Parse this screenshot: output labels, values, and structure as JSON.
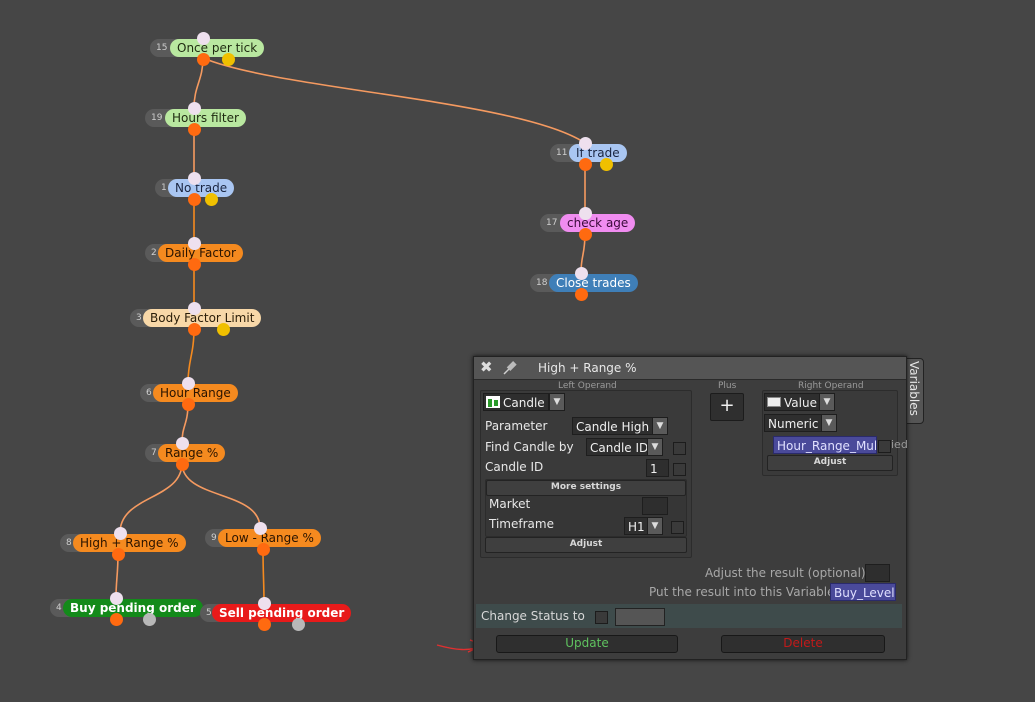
{
  "nodes": [
    {
      "id": "15",
      "label": "Once per tick",
      "color": "#b9e8a0",
      "text": "#1e2a10"
    },
    {
      "id": "19",
      "label": "Hours filter",
      "color": "#b9e8a0",
      "text": "#1e2a10"
    },
    {
      "id": "1",
      "label": "No trade",
      "color": "#a9c6f2",
      "text": "#1a2540"
    },
    {
      "id": "2",
      "label": "Daily Factor",
      "color": "#f58a1f",
      "text": "#2a1400"
    },
    {
      "id": "3",
      "label": "Body Factor Limit",
      "color": "#f8d8a8",
      "text": "#2a1d08"
    },
    {
      "id": "6",
      "label": "Hour Range",
      "color": "#f58a1f",
      "text": "#2a1400"
    },
    {
      "id": "7",
      "label": "Range %",
      "color": "#f58a1f",
      "text": "#2a1400"
    },
    {
      "id": "8",
      "label": "High + Range %",
      "color": "#f58a1f",
      "text": "#2a1400"
    },
    {
      "id": "9",
      "label": "Low - Range %",
      "color": "#f58a1f",
      "text": "#2a1400"
    },
    {
      "id": "4",
      "label": "Buy pending order",
      "color": "#138a1a",
      "text": "#ffffff"
    },
    {
      "id": "5",
      "label": "Sell pending order",
      "color": "#e81a1a",
      "text": "#ffffff"
    },
    {
      "id": "11",
      "label": "If trade",
      "color": "#a9c6f2",
      "text": "#1a2540"
    },
    {
      "id": "17",
      "label": "check age",
      "color": "#f08cf0",
      "text": "#3a0a3a"
    },
    {
      "id": "18",
      "label": "Close trades",
      "color": "#3f7fb8",
      "text": "#ffffff"
    }
  ],
  "dialog": {
    "title": "High + Range %",
    "close_icon": "close-icon",
    "pin_icon": "pin-icon",
    "variables_tab": "Variables",
    "left_operand_header": "Left Operand",
    "plus_header": "Plus",
    "right_operand_header": "Right Operand",
    "plus_symbol": "+",
    "left": {
      "type_icon": "candle-icon",
      "type": "Candle",
      "parameter_label": "Parameter",
      "parameter_value": "Candle High",
      "find_by_label": "Find Candle by",
      "find_by_value": "Candle ID",
      "candle_id_label": "Candle ID",
      "candle_id_value": "1",
      "more_settings": "More settings",
      "market_label": "Market",
      "market_value": "",
      "timeframe_label": "Timeframe",
      "timeframe_value": "H1",
      "adjust": "Adjust"
    },
    "right": {
      "type_icon": "value-icon",
      "type": "Value",
      "numeric": "Numeric",
      "variable": "Hour_Range_Mult",
      "cut_text": "ied",
      "adjust": "Adjust"
    },
    "adjust_result_label": "Adjust the result (optional):",
    "adjust_result_value": "",
    "put_result_label": "Put the result into this Variable:",
    "put_result_value": "Buy_Level",
    "change_status_label": "Change Status to",
    "change_status_value": "",
    "update_label": "Update",
    "delete_label": "Delete",
    "colors": {
      "update": "#5fc25f",
      "delete": "#c21a1a",
      "variable_bg": "#4a4a9a",
      "status_row": "#3e4b4b"
    }
  }
}
